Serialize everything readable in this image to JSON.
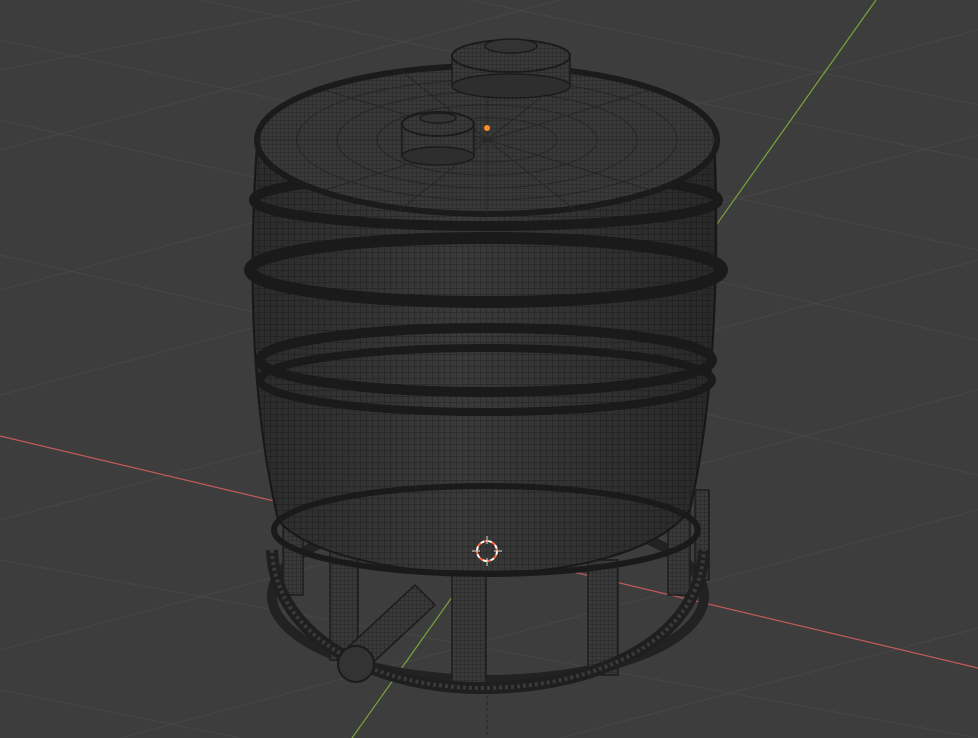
{
  "viewport": {
    "mode": "wireframe",
    "background_color": "#3d3d3d",
    "grid_color": "#474747",
    "x_axis_color": "#c25a5a",
    "y_axis_color": "#7aa33a",
    "wire_color": "#1c1c1c",
    "surface_color": "#383838",
    "origin_color": "#ff8a2a",
    "cursor_color": "#ff6b3a"
  },
  "scene": {
    "object_name": "water-tank",
    "parts": [
      "tank-lid",
      "top-hatch",
      "vent-cap",
      "barrel-body",
      "barrel-bands",
      "support-legs",
      "base-ring",
      "outlet-pipe"
    ]
  }
}
